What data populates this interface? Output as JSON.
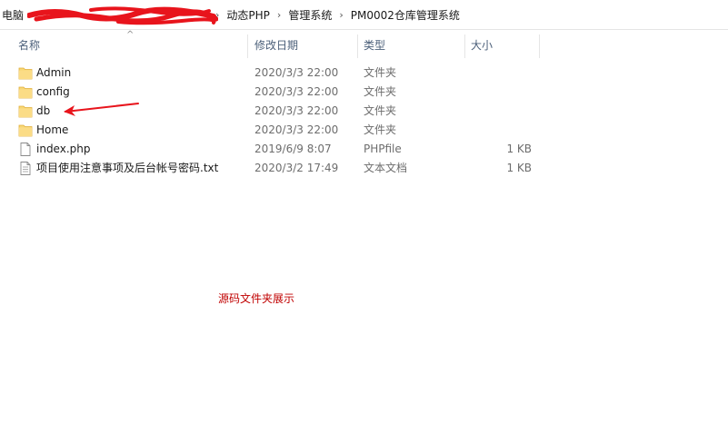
{
  "address_bar": {
    "crumbs": [
      "电脑",
      "动态PHP",
      "管理系统",
      "PM0002仓库管理系统"
    ]
  },
  "columns": {
    "name": "名称",
    "date": "修改日期",
    "type": "类型",
    "size": "大小"
  },
  "files": [
    {
      "name": "Admin",
      "date": "2020/3/3 22:00",
      "type": "文件夹",
      "size": "",
      "icon": "folder-icon"
    },
    {
      "name": "config",
      "date": "2020/3/3 22:00",
      "type": "文件夹",
      "size": "",
      "icon": "folder-icon"
    },
    {
      "name": "db",
      "date": "2020/3/3 22:00",
      "type": "文件夹",
      "size": "",
      "icon": "folder-icon"
    },
    {
      "name": "Home",
      "date": "2020/3/3 22:00",
      "type": "文件夹",
      "size": "",
      "icon": "folder-icon"
    },
    {
      "name": "index.php",
      "date": "2019/6/9 8:07",
      "type": "PHPfile",
      "size": "1 KB",
      "icon": "file-icon"
    },
    {
      "name": "项目使用注意事项及后台帐号密码.txt",
      "date": "2020/3/2 17:49",
      "type": "文本文档",
      "size": "1 KB",
      "icon": "text-file-icon"
    }
  ],
  "annotation": "源码文件夹展示",
  "colors": {
    "folder": "#f8d775",
    "folder_dark": "#e8b83e",
    "annotation_red": "#c00000",
    "header_text": "#4c607a"
  }
}
